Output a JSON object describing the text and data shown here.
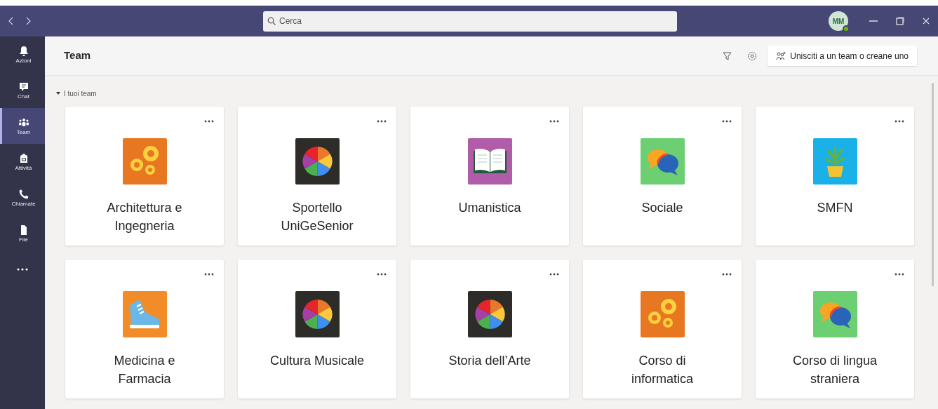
{
  "title_bar": {
    "search": {
      "placeholder": "Cerca"
    },
    "avatar": {
      "initials": "MM"
    }
  },
  "sidebar": {
    "items": [
      {
        "label": "Azioni",
        "kind": "bell",
        "selected": false
      },
      {
        "label": "Chat",
        "kind": "chat",
        "selected": false
      },
      {
        "label": "Team",
        "kind": "team",
        "selected": true
      },
      {
        "label": "Attività",
        "kind": "bag",
        "selected": false
      },
      {
        "label": "Chiamate",
        "kind": "phone",
        "selected": false
      },
      {
        "label": "File",
        "kind": "file",
        "selected": false
      }
    ]
  },
  "header": {
    "title": "Team",
    "join_button": "Unisciti a un team o creane uno"
  },
  "section": {
    "label": "I tuoi team",
    "expanded": true
  },
  "teams": [
    {
      "name": "Architettura e Ingegneria",
      "kind": "gears"
    },
    {
      "name": "Sportello UniGeSenior",
      "kind": "pie"
    },
    {
      "name": "Umanistica",
      "kind": "book"
    },
    {
      "name": "Sociale",
      "kind": "chat"
    },
    {
      "name": "SMFN",
      "kind": "plant"
    },
    {
      "name": "Medicina e Farmacia",
      "kind": "shoe"
    },
    {
      "name": "Cultura Musicale",
      "kind": "pie"
    },
    {
      "name": "Storia dell’Arte",
      "kind": "pie"
    },
    {
      "name": "Corso di informatica",
      "kind": "gears"
    },
    {
      "name": "Corso di lingua straniera",
      "kind": "chat"
    }
  ]
}
